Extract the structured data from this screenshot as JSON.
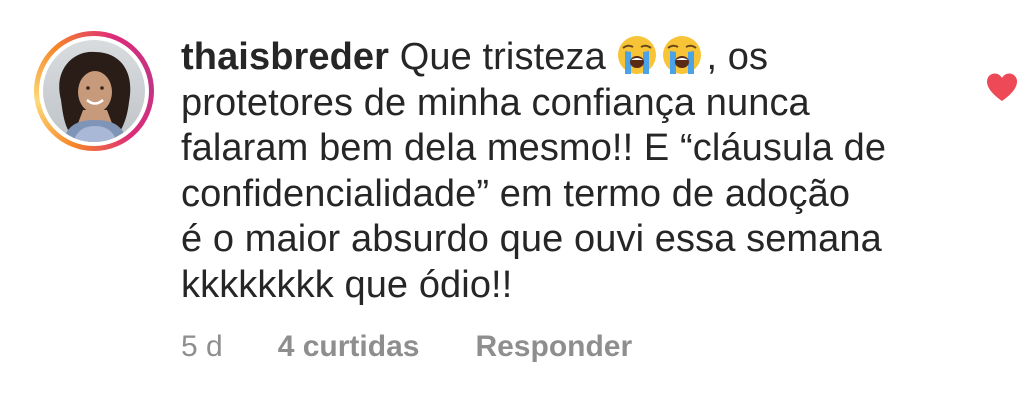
{
  "comment": {
    "username": "thaisbreder",
    "text_line1_before_emoji": "Que tristeza",
    "emojis": [
      "loudly-crying-face-emoji",
      "loudly-crying-face-emoji"
    ],
    "text_line1_after_emoji": ", os",
    "lines": [
      "protetores de minha confiança nunca",
      "falaram bem dela mesmo!! E “cláusula de",
      "confidencialidade” em termo de adoção",
      "é o maior absurdo que ouvi essa semana",
      "kkkkkkkk que ódio!!"
    ],
    "time": "5 d",
    "likes": "4 curtidas",
    "reply_label": "Responder",
    "liked": true
  },
  "colors": {
    "text": "#262626",
    "meta": "#8e8e8e",
    "heart": "#ed4956"
  },
  "icons": {
    "like": "heart-icon",
    "avatar": "profile-photo"
  }
}
